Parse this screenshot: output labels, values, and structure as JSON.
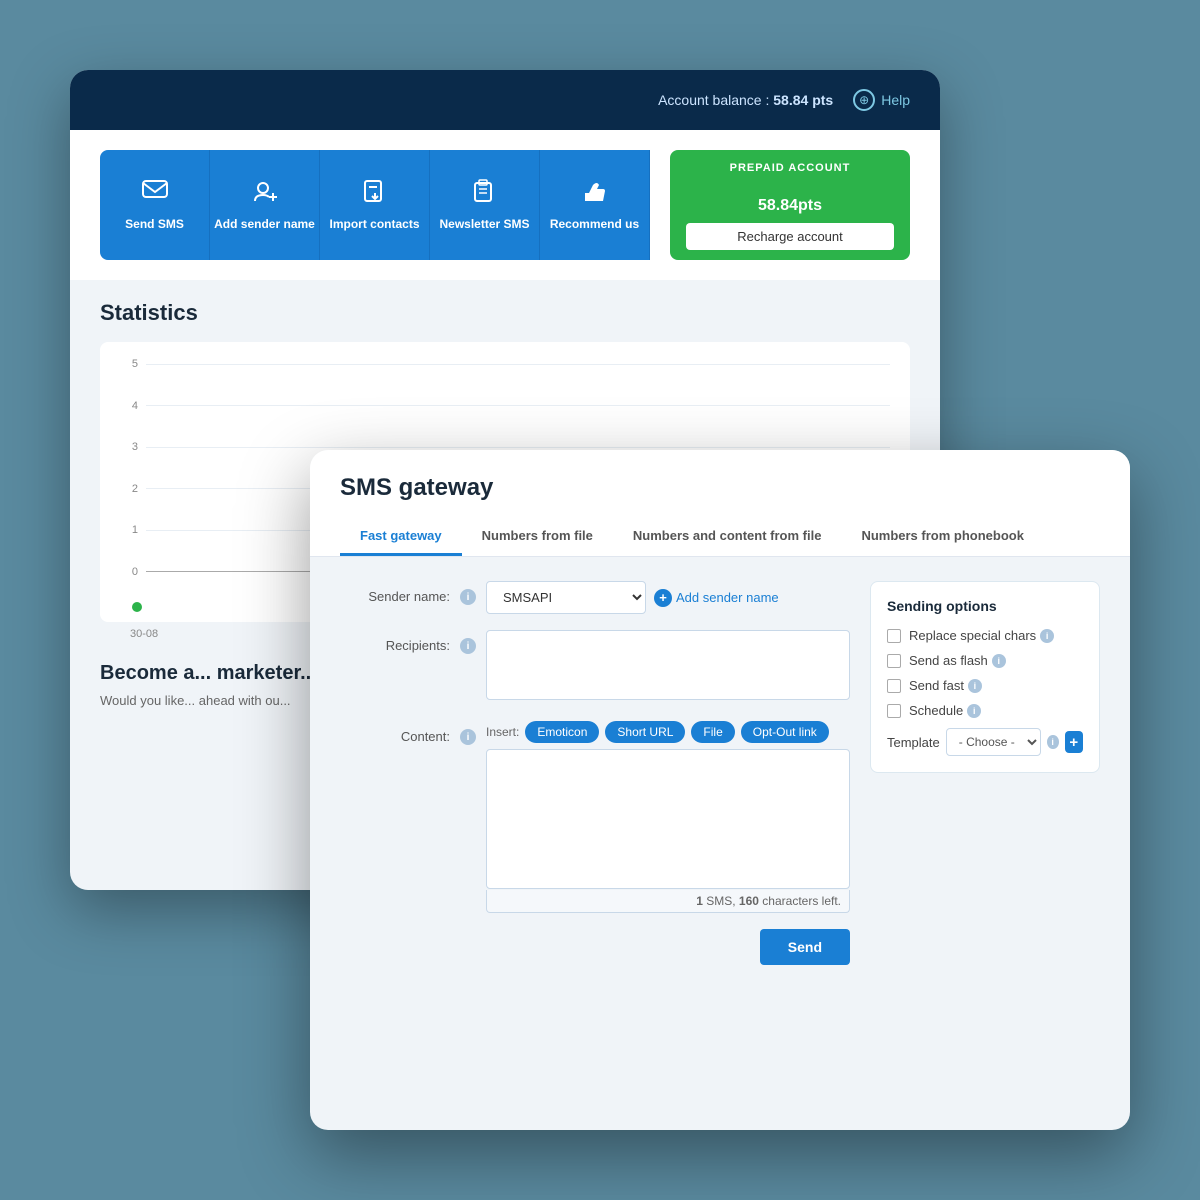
{
  "header": {
    "account_balance_label": "Account balance :",
    "account_balance_value": "58.84 pts",
    "help_label": "Help"
  },
  "action_buttons": [
    {
      "id": "send-sms",
      "icon": "💬",
      "label": "Send\nSMS"
    },
    {
      "id": "add-sender",
      "icon": "👤",
      "label": "Add\nsender name"
    },
    {
      "id": "import-contacts",
      "icon": "📥",
      "label": "Import\ncontacts"
    },
    {
      "id": "newsletter-sms",
      "icon": "📱",
      "label": "Newsletter\nSMS"
    },
    {
      "id": "recommend-us",
      "icon": "👍",
      "label": "Recommend\nus"
    }
  ],
  "prepaid": {
    "label": "PREPAID ACCOUNT",
    "amount": "58.84",
    "unit": "pts",
    "recharge_label": "Recharge account"
  },
  "stats": {
    "title": "Statistics",
    "y_labels": [
      "5",
      "4",
      "3",
      "2",
      "1",
      "0"
    ],
    "x_label": "30-08"
  },
  "bottom_section": {
    "title": "Becom... market...",
    "subtitle": "Would you lik... ahead with ou..."
  },
  "gateway": {
    "title": "SMS gateway",
    "tabs": [
      {
        "id": "fast-gateway",
        "label": "Fast gateway",
        "active": true
      },
      {
        "id": "numbers-from-file",
        "label": "Numbers from file",
        "active": false
      },
      {
        "id": "numbers-content-from-file",
        "label": "Numbers and content from file",
        "active": false
      },
      {
        "id": "numbers-from-phonebook",
        "label": "Numbers from phonebook",
        "active": false
      }
    ],
    "form": {
      "sender_name_label": "Sender name:",
      "sender_name_value": "SMSAPI",
      "add_sender_label": "Add sender name",
      "recipients_label": "Recipients:",
      "content_label": "Content:",
      "insert_label": "Insert:",
      "insert_buttons": [
        "Emoticon",
        "Short URL",
        "File",
        "Opt-Out link"
      ],
      "sms_count": "1",
      "chars_left": "160",
      "sms_counter_text": " SMS, ",
      "chars_label": " characters left.",
      "send_label": "Send"
    },
    "sending_options": {
      "title": "Sending options",
      "options": [
        {
          "id": "replace-special-chars",
          "label": "Replace special chars"
        },
        {
          "id": "send-as-flash",
          "label": "Send as flash"
        },
        {
          "id": "send-fast",
          "label": "Send fast"
        },
        {
          "id": "schedule",
          "label": "Schedule"
        }
      ],
      "template_label": "Template",
      "template_placeholder": "- Choose -",
      "template_options": [
        "- Choose -"
      ]
    }
  }
}
